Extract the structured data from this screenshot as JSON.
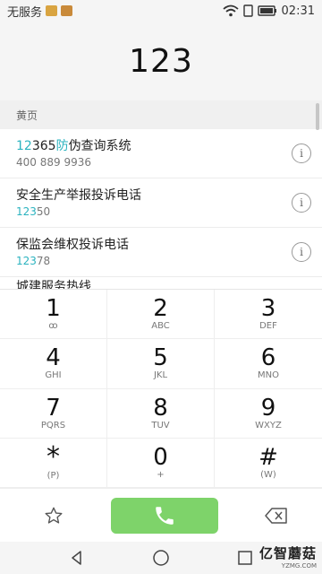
{
  "status_bar": {
    "carrier": "无服务",
    "battery": "02:31"
  },
  "dialer": {
    "number": "123"
  },
  "results": {
    "section_title": "黄页",
    "entries": [
      {
        "title_hl1": "12",
        "title_mid": "365",
        "title_hl2": "防",
        "title_rest": "伪查询系统",
        "sub_hl": "",
        "sub_rest": "400 889 9936"
      },
      {
        "title": "安全生产举报投诉电话",
        "sub_hl": "123",
        "sub_rest": "50"
      },
      {
        "title": "保监会维权投诉电话",
        "sub_hl": "123",
        "sub_rest": "78"
      }
    ],
    "partial_label": "城建服务热线"
  },
  "keypad": [
    {
      "digit": "1",
      "letters": "ꝏ"
    },
    {
      "digit": "2",
      "letters": "ABC"
    },
    {
      "digit": "3",
      "letters": "DEF"
    },
    {
      "digit": "4",
      "letters": "GHI"
    },
    {
      "digit": "5",
      "letters": "JKL"
    },
    {
      "digit": "6",
      "letters": "MNO"
    },
    {
      "digit": "7",
      "letters": "PQRS"
    },
    {
      "digit": "8",
      "letters": "TUV"
    },
    {
      "digit": "9",
      "letters": "WXYZ"
    },
    {
      "digit": "*",
      "letters": "(P)"
    },
    {
      "digit": "0",
      "letters": "+"
    },
    {
      "digit": "#",
      "letters": "(W)"
    }
  ],
  "colors": {
    "accent": "#2bb3bf",
    "call": "#7ed36a"
  },
  "icons": [
    "wifi-icon",
    "battery-icon",
    "info-icon",
    "star-icon",
    "phone-icon",
    "backspace-icon",
    "back-icon",
    "home-icon",
    "recents-icon"
  ],
  "watermark": {
    "main": "亿智蘑菇",
    "sub": "YZMG.COM"
  }
}
